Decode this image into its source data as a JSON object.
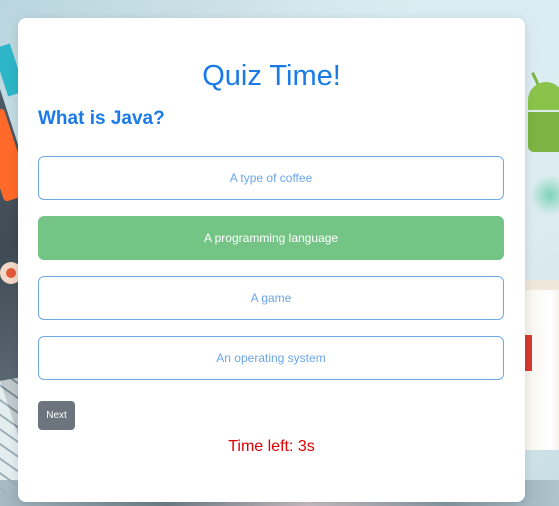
{
  "quiz": {
    "title": "Quiz Time!",
    "question": "What is Java?",
    "options": [
      {
        "label": "A type of coffee",
        "selected": false
      },
      {
        "label": "A programming language",
        "selected": true
      },
      {
        "label": "A game",
        "selected": false
      },
      {
        "label": "An operating system",
        "selected": false
      }
    ],
    "next_label": "Next",
    "timer_text": "Time left: 3s"
  },
  "colors": {
    "accent": "#1a7be6",
    "selected": "#74c486",
    "option_border": "#6fa9ea",
    "timer": "#e00000",
    "next_button": "#6c757d"
  }
}
